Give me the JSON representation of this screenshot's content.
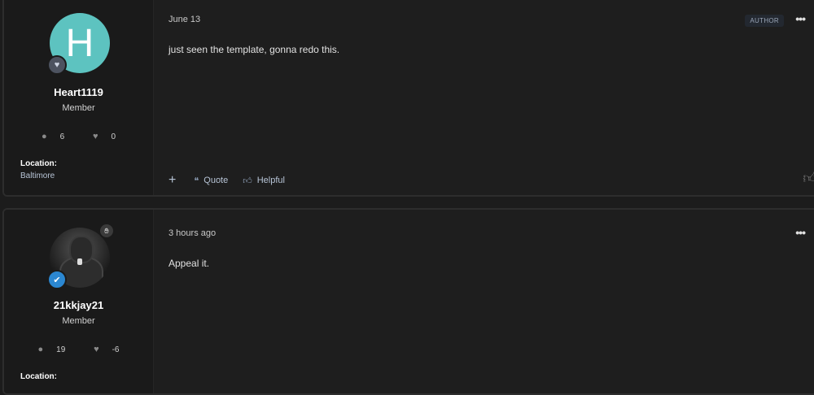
{
  "posts": [
    {
      "user": {
        "avatar_letter": "H",
        "avatar_color": "#5dc3c0",
        "rank_icon": "shield-heart-icon",
        "username": "Heart1119",
        "role": "Member",
        "messages": "6",
        "reactions": "0",
        "location_label": "Location:",
        "location": "Baltimore"
      },
      "date": "June 13",
      "author_badge": "AUTHOR",
      "content": "just seen the template, gonna redo this.",
      "actions": {
        "quote": "Quote",
        "helpful": "Helpful"
      }
    },
    {
      "user": {
        "avatar_icon": "user-photo-avatar",
        "rank_icon": "blue-shield-icon",
        "username": "21kkjay21",
        "role": "Member",
        "messages": "19",
        "reactions": "-6",
        "location_label": "Location:"
      },
      "date": "3 hours ago",
      "content": "Appeal it."
    }
  ],
  "colors": {
    "background": "#1c1c1c",
    "accent": "#b7c4d6"
  }
}
